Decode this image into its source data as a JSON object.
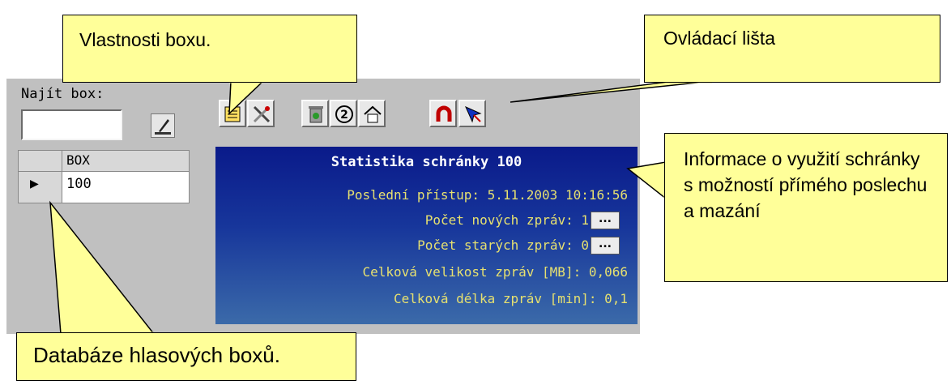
{
  "find": {
    "label": "Najít box:",
    "value": ""
  },
  "grid": {
    "header": "BOX",
    "row_indicator": "▶",
    "rows": [
      "100"
    ]
  },
  "stats": {
    "title": "Statistika schránky 100",
    "last_access": "Poslední přístup: 5.11.2003 10:16:56",
    "new_messages": "Počet nových zpráv: 1",
    "old_messages": "Počet starých zpráv: 0",
    "total_size": "Celková velikost zpráv [MB]: 0,066",
    "total_length": "Celková délka zpráv [min]: 0,1",
    "dots_label": "..."
  },
  "toolbar": {
    "icons": [
      "box-properties-icon",
      "tools-icon",
      "recycle-icon",
      "number-2-icon",
      "house-icon",
      "magnet-icon",
      "cursor-icon"
    ]
  },
  "callouts": {
    "properties": "Vlastnosti boxu.",
    "toolbar": "Ovládací lišta",
    "info": "Informace o využití schránky s možností přímého poslechu a mazání",
    "database": "Databáze hlasových boxů."
  },
  "colors": {
    "panel": "#c0c0c0",
    "stats_top": "#0a1a8a",
    "stats_bottom": "#3b6aa9",
    "stats_text": "#e6e070",
    "callout_bg": "#ffff99"
  }
}
